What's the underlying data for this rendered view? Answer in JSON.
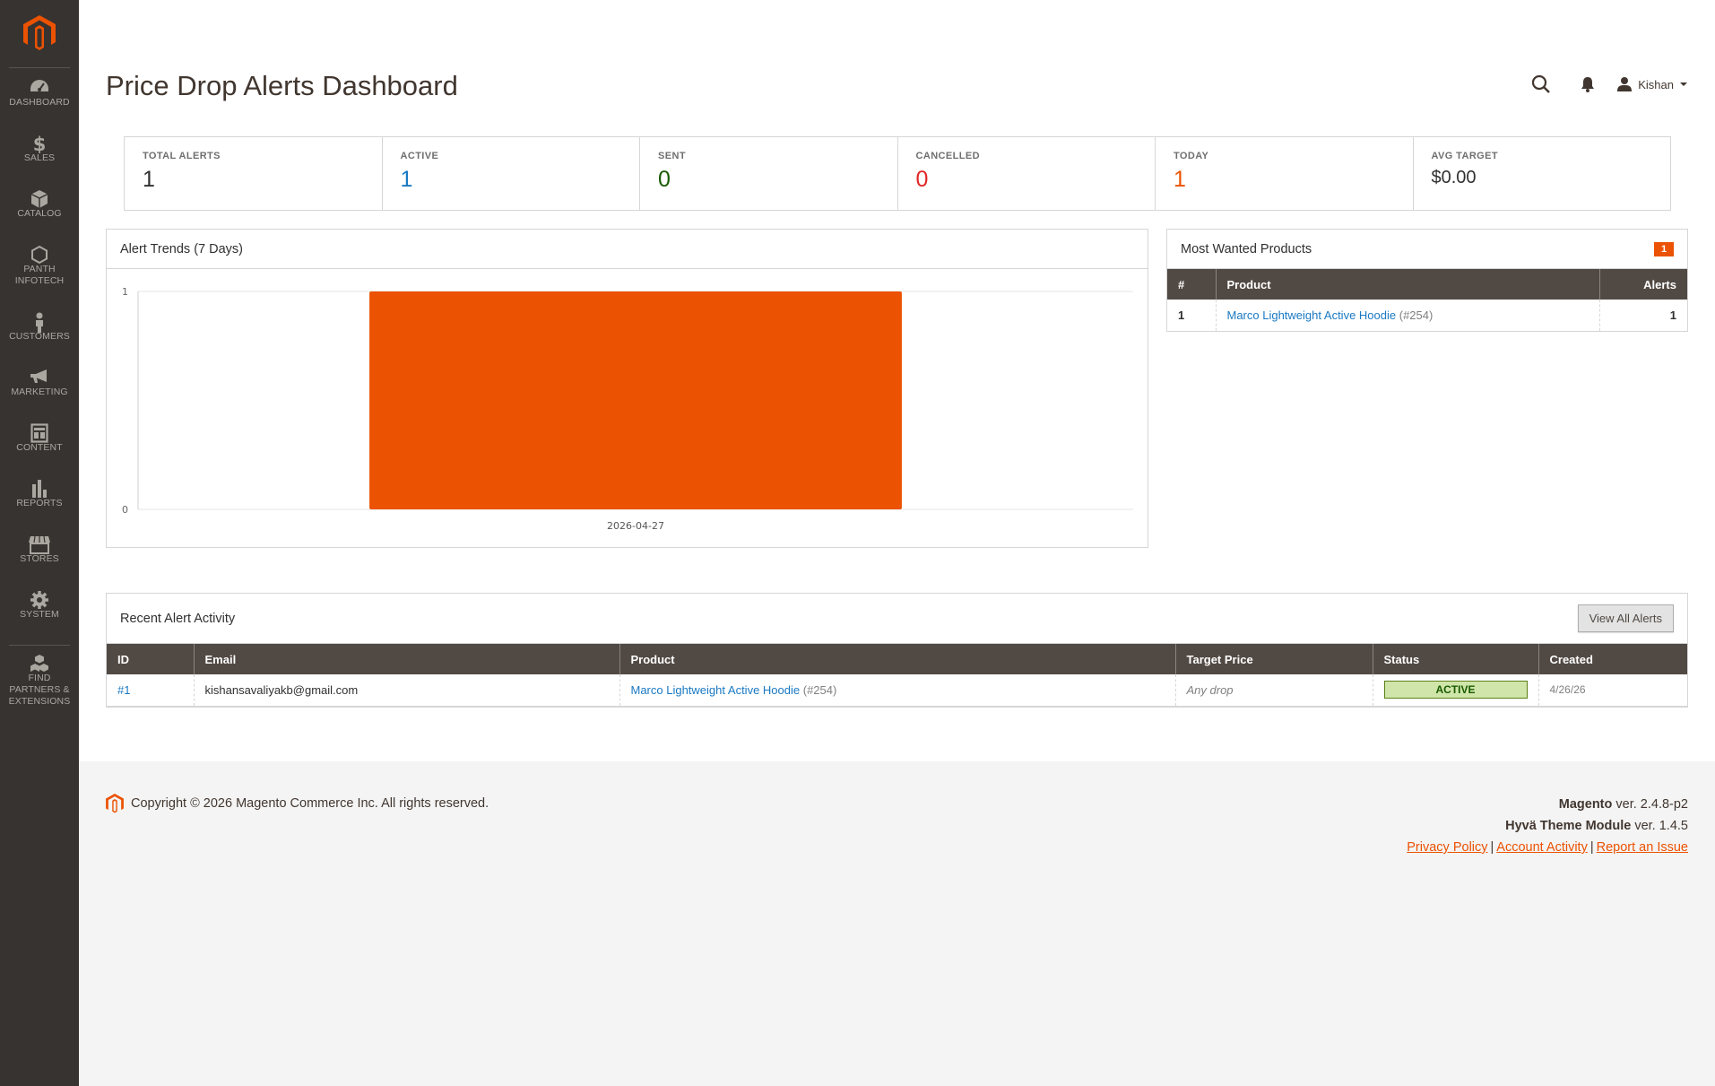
{
  "sidebar": {
    "logo": "magento-logo",
    "items": [
      {
        "label": "DASHBOARD",
        "icon": "dashboard-icon"
      },
      {
        "label": "SALES",
        "icon": "dollar-icon"
      },
      {
        "label": "CATALOG",
        "icon": "box-icon"
      },
      {
        "label": "PANTH INFOTECH",
        "icon": "hexagon-icon"
      },
      {
        "label": "CUSTOMERS",
        "icon": "person-icon"
      },
      {
        "label": "MARKETING",
        "icon": "megaphone-icon"
      },
      {
        "label": "CONTENT",
        "icon": "layout-icon"
      },
      {
        "label": "REPORTS",
        "icon": "bar-chart-icon"
      },
      {
        "label": "STORES",
        "icon": "storefront-icon"
      },
      {
        "label": "SYSTEM",
        "icon": "gear-icon"
      },
      {
        "label": "FIND PARTNERS & EXTENSIONS",
        "icon": "cubes-icon"
      }
    ]
  },
  "header": {
    "title": "Price Drop Alerts Dashboard",
    "user": "Kishan"
  },
  "stats": [
    {
      "label": "TOTAL ALERTS",
      "value": "1",
      "color": "#303030"
    },
    {
      "label": "ACTIVE",
      "value": "1",
      "color": "#1979c3"
    },
    {
      "label": "SENT",
      "value": "0",
      "color": "#185b00"
    },
    {
      "label": "CANCELLED",
      "value": "0",
      "color": "#e22626"
    },
    {
      "label": "TODAY",
      "value": "1",
      "color": "#eb5202"
    },
    {
      "label": "AVG TARGET",
      "value": "$0.00",
      "color": "#303030"
    }
  ],
  "chart_panel": {
    "title": "Alert Trends (7 Days)"
  },
  "chart_data": {
    "type": "bar",
    "categories": [
      "2026-04-27"
    ],
    "values": [
      1
    ],
    "ylim": [
      0,
      1
    ],
    "yticks": [
      "0",
      "1"
    ],
    "bar_color": "#eb5202",
    "grid": true
  },
  "wanted": {
    "title": "Most Wanted Products",
    "badge": "1",
    "columns": [
      "#",
      "Product",
      "Alerts"
    ],
    "rows": [
      {
        "rank": "1",
        "product": "Marco Lightweight Active Hoodie",
        "product_id": "(#254)",
        "alerts": "1"
      }
    ]
  },
  "recent": {
    "title": "Recent Alert Activity",
    "button": "View All Alerts",
    "columns": [
      "ID",
      "Email",
      "Product",
      "Target Price",
      "Status",
      "Created"
    ],
    "rows": [
      {
        "id": "#1",
        "email": "kishansavaliyakb@gmail.com",
        "product": "Marco Lightweight Active Hoodie",
        "product_id": "(#254)",
        "target": "Any drop",
        "status": "ACTIVE",
        "created": "4/26/26"
      }
    ]
  },
  "footer": {
    "copyright": "Copyright © 2026 Magento Commerce Inc. All rights reserved.",
    "magento_name": "Magento",
    "magento_ver": "ver. 2.4.8-p2",
    "hyva_name": "Hyvä Theme Module",
    "hyva_ver": "ver. 1.4.5",
    "links": [
      "Privacy Policy",
      "Account Activity",
      "Report an Issue"
    ]
  }
}
